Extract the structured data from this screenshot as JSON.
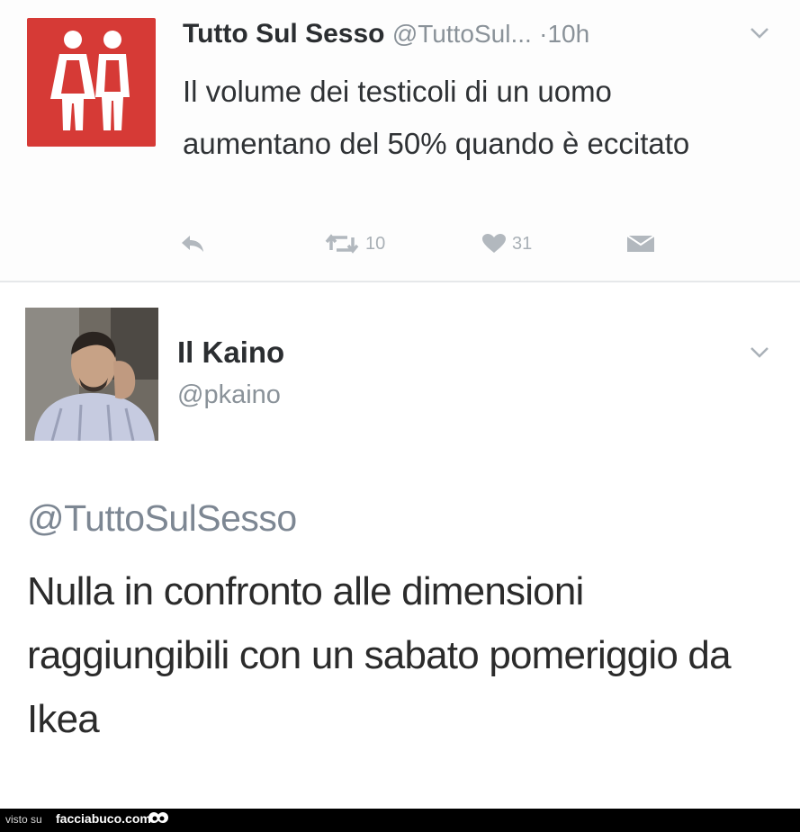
{
  "tweet1": {
    "author_name": "Tutto Sul Sesso",
    "author_handle": "@TuttoSul...",
    "time": "·10h",
    "text": "Il volume dei testicoli di un uomo aumentano del 50% quando è eccitato",
    "retweets": "10",
    "likes": "31",
    "logo_color": "#d63a36"
  },
  "tweet2": {
    "author_name": "Il Kaino",
    "author_handle": "@pkaino",
    "mention": "@TuttoSulSesso",
    "text": "Nulla in confronto alle dimensioni raggiungibili con un sabato pomeriggio da Ikea"
  },
  "footer": {
    "prefix": "visto su",
    "site": "facciabuco.com"
  },
  "icons": [
    "couple-logo-icon",
    "reply-icon",
    "retweet-icon",
    "heart-icon",
    "dm-icon",
    "chevron-down-icon",
    "eyes-icon"
  ]
}
